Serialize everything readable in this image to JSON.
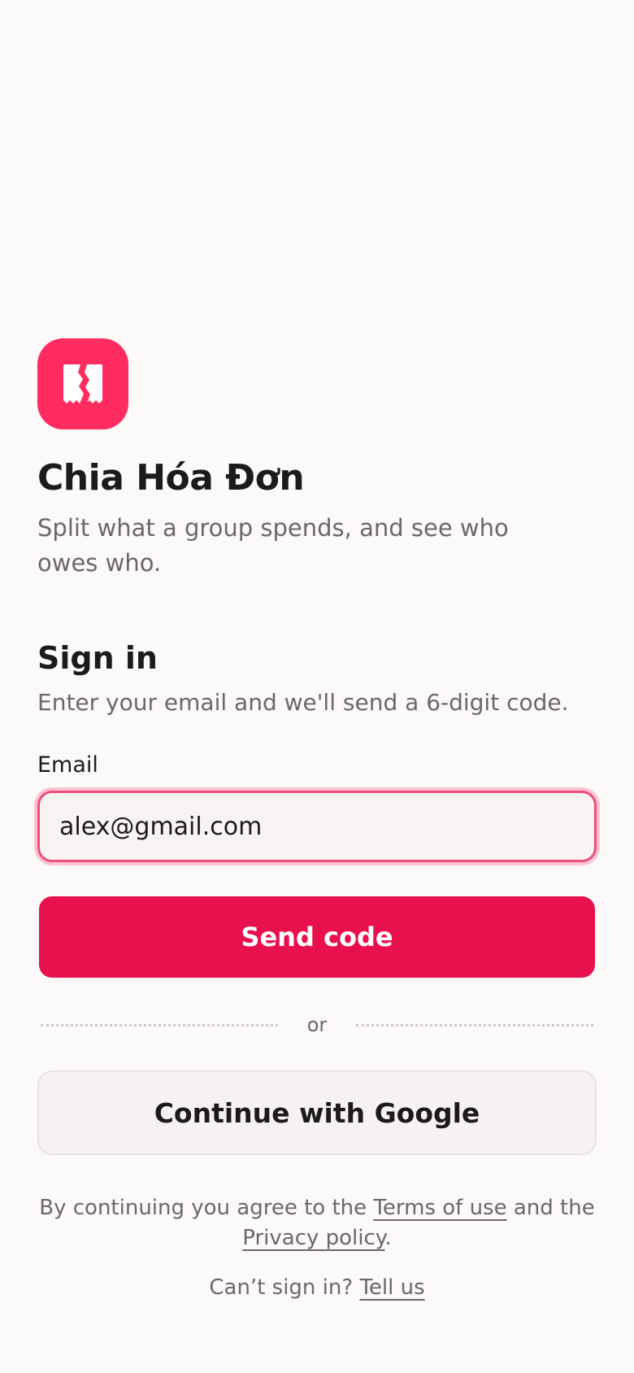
{
  "brand": {
    "app_name": "Chia Hóa Đơn",
    "tagline": "Split what a group spends, and see who owes who.",
    "logo_icon": "split-receipt-icon",
    "accent_color": "#ff2d5f"
  },
  "signin": {
    "title": "Sign in",
    "subtitle": "Enter your email and we'll send a 6-digit code.",
    "email_label": "Email",
    "email_value": "alex@gmail.com",
    "send_button": "Send code",
    "divider": "or",
    "google_button": "Continue with Google",
    "button_color": "#e8104d"
  },
  "legal": {
    "prefix": "By continuing you agree to the ",
    "terms_link": "Terms of use",
    "middle": " and the ",
    "privacy_link": "Privacy policy",
    "suffix": "."
  },
  "help": {
    "prefix": "Can’t sign in? ",
    "link": "Tell us"
  }
}
